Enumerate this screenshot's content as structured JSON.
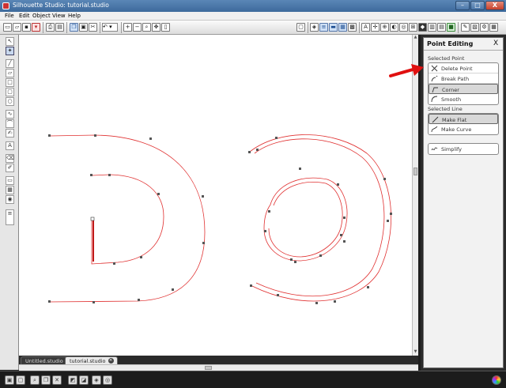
{
  "window": {
    "title": "Silhouette Studio: tutorial.studio",
    "minimize": "–",
    "maximize": "□",
    "close": "X"
  },
  "menu": [
    {
      "id": "file",
      "label": "File"
    },
    {
      "id": "edit",
      "label": "Edit"
    },
    {
      "id": "object",
      "label": "Object"
    },
    {
      "id": "view",
      "label": "View"
    },
    {
      "id": "help",
      "label": "Help"
    }
  ],
  "toolbar": {
    "text_tool_label": "A"
  },
  "left_tools": {
    "text_tool_label": "A"
  },
  "tabs": [
    {
      "label": "Untitled.studio",
      "active": false
    },
    {
      "label": "tutorial.studio",
      "active": true
    }
  ],
  "panel": {
    "title": "Point Editing",
    "close": "X",
    "selected_point_label": "Selected Point",
    "point_actions": [
      {
        "id": "delete-point",
        "label": "Delete Point",
        "selected": false,
        "icon": "delete-point-icon"
      },
      {
        "id": "break-path",
        "label": "Break Path",
        "selected": false,
        "icon": "break-path-icon"
      },
      {
        "id": "corner",
        "label": "Corner",
        "selected": true,
        "icon": "corner-icon"
      },
      {
        "id": "smooth",
        "label": "Smooth",
        "selected": false,
        "icon": "smooth-icon"
      }
    ],
    "selected_line_label": "Selected Line",
    "line_actions": [
      {
        "id": "make-flat",
        "label": "Make Flat",
        "selected": true,
        "icon": "make-flat-icon"
      },
      {
        "id": "make-curve",
        "label": "Make Curve",
        "selected": false,
        "icon": "make-curve-icon"
      }
    ],
    "simplify_label": "Simplify"
  },
  "colors": {
    "path_stroke": "#e03030",
    "anchor_point": "#555555",
    "annotation_arrow": "#e01010",
    "titlebar": "#4a76a8"
  }
}
